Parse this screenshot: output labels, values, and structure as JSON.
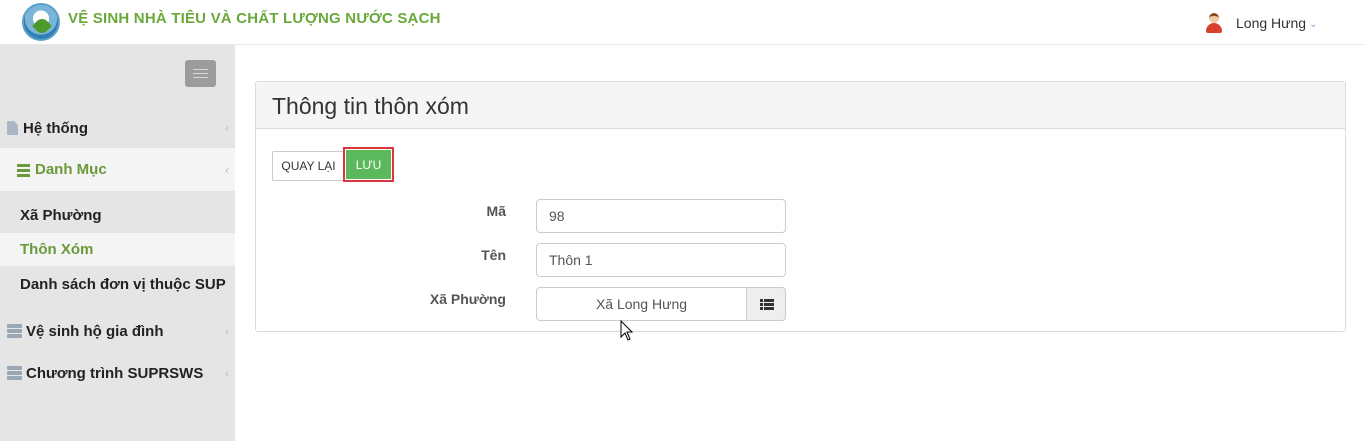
{
  "header": {
    "title": "VỆ SINH NHÀ TIÊU VÀ CHẤT LƯỢNG NƯỚC SẠCH",
    "user_name": "Long Hưng"
  },
  "sidebar": {
    "items": [
      {
        "label": "Hệ thống"
      },
      {
        "label": "Danh Mục"
      },
      {
        "label": "Vệ sinh hộ gia đình"
      },
      {
        "label": "Chương trình SUPRSWS"
      }
    ],
    "subitems": [
      {
        "label": "Xã Phường"
      },
      {
        "label": "Thôn Xóm"
      },
      {
        "label": "Danh sách đơn vị thuộc SUP"
      }
    ]
  },
  "panel": {
    "title": "Thông tin thôn xóm",
    "back_label": "QUAY LẠI",
    "save_label": "LƯU",
    "fields": {
      "ma_label": "Mã",
      "ma_value": "98",
      "ten_label": "Tên",
      "ten_value": "Thôn 1",
      "xa_label": "Xã Phường",
      "xa_value": "Xã Long Hưng"
    }
  },
  "icons": {
    "logo": "app-logo-icon",
    "user": "user-avatar-icon",
    "menu_toggle": "hamburger-icon",
    "he_thong": "file-icon",
    "danh_muc": "list-icon",
    "ve_sinh": "server-icon",
    "chuong_trinh": "server-icon",
    "lookup": "list-lookup-icon"
  },
  "colors": {
    "brand_green": "#6aa83a",
    "save_button": "#5cb85c",
    "highlight_border": "#d9363e"
  }
}
